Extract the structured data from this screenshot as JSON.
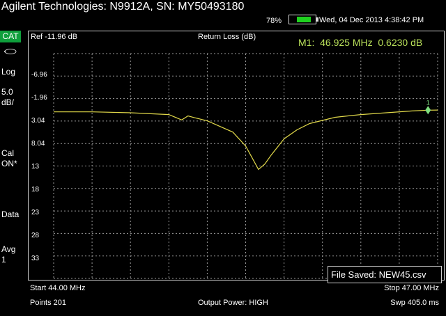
{
  "header": {
    "title": "Agilent Technologies: N9912A, SN: MY50493180",
    "battery_percent": "78%",
    "battery_level": 0.78,
    "datetime": "Wed, 04 Dec 2013 4:38:42 PM"
  },
  "sidebar": {
    "cat": "CAT",
    "scale_mode": "Log",
    "scale_per_div": "5.0\ndB/",
    "cal": "Cal\nON*",
    "data": "Data",
    "avg": "Avg\n1"
  },
  "plot": {
    "ref_label": "Ref -11.96 dB",
    "measurement": "Return Loss (dB)",
    "marker_readout": "M1:  46.925 MHz  0.6230 dB",
    "marker_number": "1",
    "y_tick_labels": [
      "-6.96",
      "-1.96",
      "3.04",
      "8.04",
      "13",
      "18",
      "23",
      "28",
      "33"
    ],
    "trace_color": "#e0d84a",
    "marker_color": "#7fe07f"
  },
  "chart_data": {
    "type": "line",
    "x_range": [
      44.0,
      47.0
    ],
    "y_range": [
      -11.96,
      38.04
    ],
    "y_inverted": true,
    "grid": true,
    "series": [
      {
        "x": [
          44.0,
          44.3,
          44.6,
          44.9,
          45.0,
          45.05,
          45.1,
          45.2,
          45.4,
          45.5,
          45.55,
          45.6,
          45.65,
          45.7,
          45.8,
          45.9,
          46.0,
          46.2,
          46.4,
          46.6,
          46.8,
          46.925,
          47.0
        ],
        "y": [
          1.0,
          1.0,
          1.2,
          1.6,
          2.8,
          1.9,
          2.3,
          3.0,
          5.5,
          8.6,
          11.2,
          13.8,
          12.6,
          10.6,
          7.0,
          5.0,
          3.6,
          2.2,
          1.6,
          1.2,
          0.8,
          0.623,
          0.6
        ]
      }
    ]
  },
  "toast": "File Saved: NEW45.csv",
  "footer": {
    "start": "Start 44.00 MHz",
    "stop": "Stop 47.00 MHz",
    "points": "Points 201",
    "power": "Output Power: HIGH",
    "sweep": "Swp 405.0 ms"
  }
}
